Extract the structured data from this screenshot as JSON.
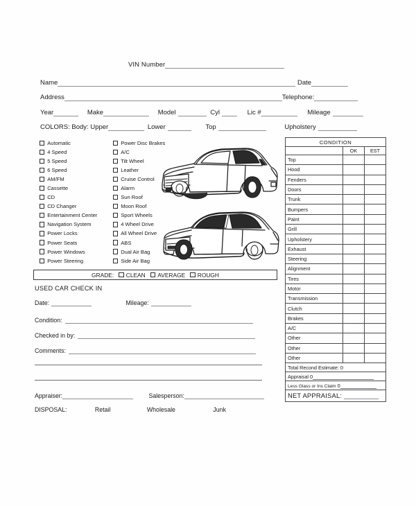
{
  "header": {
    "vin_label": "VIN Number",
    "name_label": "Name",
    "date_label": "Date",
    "address_label": "Address",
    "telephone_label": "Telephone:",
    "year_label": "Year",
    "make_label": "Make",
    "model_label": "Model",
    "cyl_label": "Cyl",
    "lic_label": "Lic #",
    "mileage_label": "Mileage",
    "colors_label": "COLORS: Body: Upper",
    "lower_label": "Lower",
    "top_label": "Top",
    "upholstery_label": "Upholstery"
  },
  "options": {
    "column_1": [
      "Automatic",
      "4 Speed",
      "5 Speed",
      "6 Speed",
      "AM/FM",
      "Cassette",
      "CD",
      "CD Changer",
      "Entertainment Center",
      "Navigation System",
      "Power Locks",
      "Power Seats",
      "Power Windows",
      "Power Steering"
    ],
    "column_2": [
      "Power Disc Brakes",
      "A/C",
      "Tilt Wheel",
      "Leather",
      "Cruise Control",
      "Alarm",
      "Sun Roof",
      "Moon Roof",
      "Sport Wheels",
      "4 Wheel Drive",
      "All Wheel Drive",
      "ABS",
      "Dual Air Bag",
      "Side Air Bag"
    ]
  },
  "grade": {
    "label": "GRADE:",
    "options": [
      "CLEAN",
      "AVERAGE",
      "ROUGH"
    ]
  },
  "checkin": {
    "title": "USED CAR CHECK IN",
    "date_label": "Date:",
    "mileage_label": "Mileage:",
    "condition_label": "Condition:",
    "checked_in_by_label": "Checked in by:",
    "comments_label": "Comments:",
    "appraiser_label": "Appraiser:",
    "salesperson_label": "Salesperson:",
    "disposal_label": "DISPOSAL:",
    "disposal_options": [
      "Retail",
      "Wholesale",
      "Junk"
    ]
  },
  "condition_table": {
    "title": "CONDITION",
    "col_ok": "OK",
    "col_est": "EST",
    "rows": [
      "Top",
      "Hood",
      "Fenders",
      "Doors",
      "Trunk",
      "Bumpers",
      "Paint",
      "Grill",
      "Upholstery",
      "Exhaust",
      "Steering",
      "Alignment",
      "Tires",
      "Motor",
      "Transmission",
      "Clutch",
      "Brakes",
      "A/C",
      "Other",
      "Other",
      "Other"
    ],
    "total_recond_label": "Total Recond Estimate:",
    "total_recond_value": "0",
    "appraisal_label": "Appraisal",
    "appraisal_value": "0",
    "less_glass_label": "Less Glass or Ins Claim",
    "less_glass_value": "0",
    "net_appraisal_label": "NET APPRAISAL:"
  },
  "illustration": {
    "top_car": "car-front-three-quarter-view",
    "bottom_car": "car-rear-three-quarter-view"
  }
}
